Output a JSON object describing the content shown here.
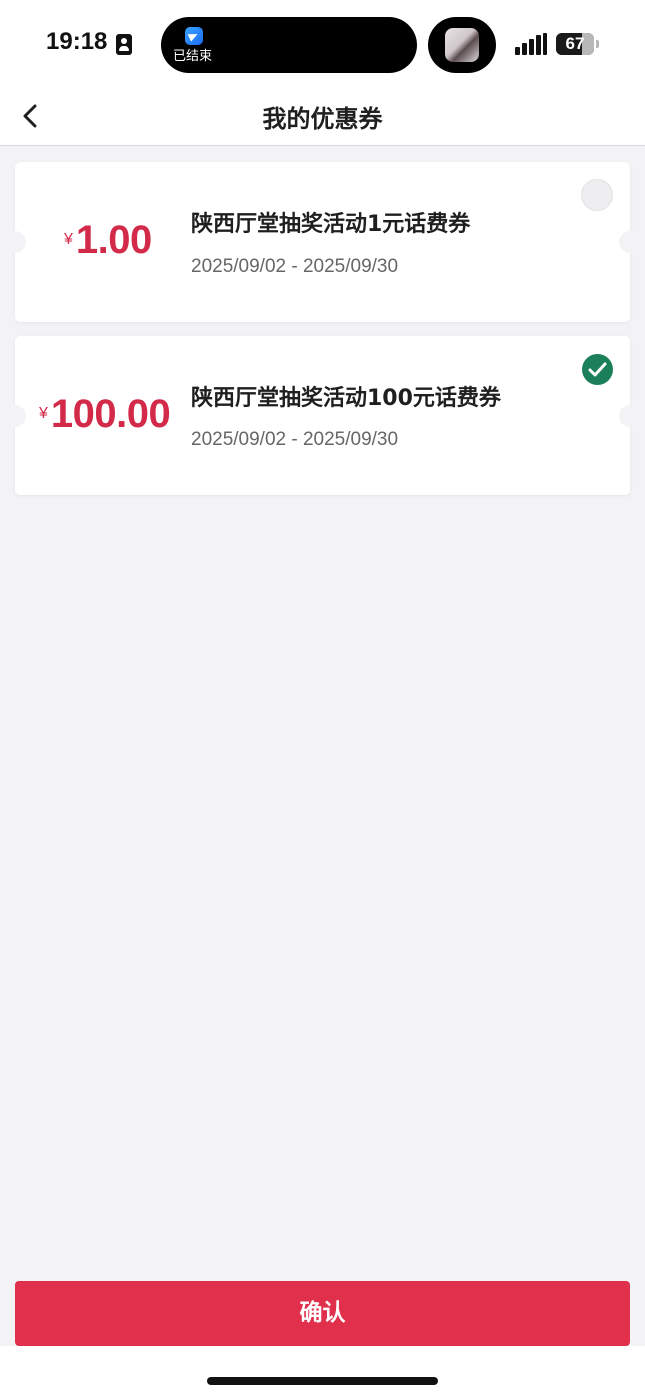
{
  "status_bar": {
    "time": "19:18",
    "island_text": "已结束",
    "battery": "67"
  },
  "nav": {
    "title": "我的优惠券"
  },
  "coupons": [
    {
      "currency": "¥",
      "amount": "1.00",
      "title": "陕西厅堂抽奖活动1元话费券",
      "date_range": "2025/09/02 - 2025/09/30",
      "selected": false
    },
    {
      "currency": "¥",
      "amount": "100.00",
      "title": "陕西厅堂抽奖活动100元话费券",
      "date_range": "2025/09/02 - 2025/09/30",
      "selected": true
    }
  ],
  "footer": {
    "confirm_label": "确认"
  },
  "colors": {
    "accent": "#e0304c",
    "amount": "#d32a4a",
    "check": "#1b7f5a",
    "background": "#f3f3f5"
  }
}
